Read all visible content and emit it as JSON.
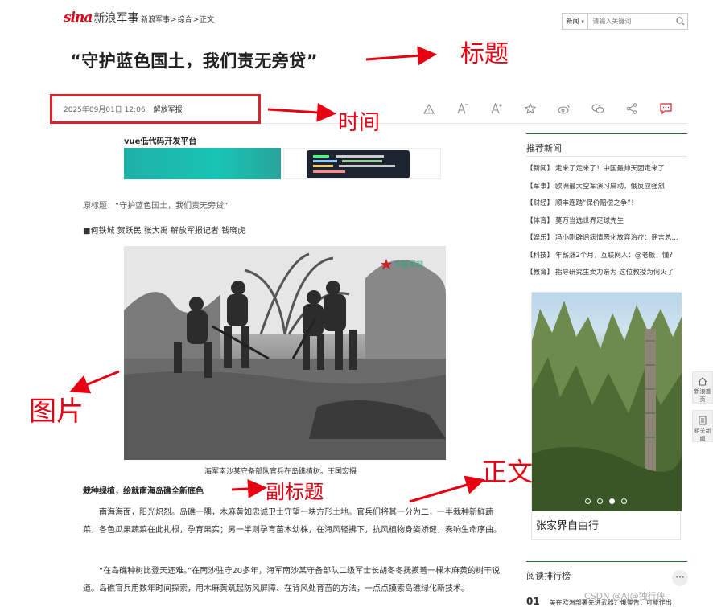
{
  "header": {
    "logo_brand": "sina",
    "logo_channel": "新浪军事",
    "breadcrumb": [
      "新浪军事",
      ">",
      "综合",
      ">",
      "正文"
    ],
    "search": {
      "scope": "新闻",
      "placeholder": "请输入关键词"
    }
  },
  "article": {
    "title": "“守护蓝色国土，我们责无旁贷”",
    "date": "2025年09月01日 12:06",
    "source": "解放军报",
    "toolbar": [
      "report-icon",
      "font-decrease-icon",
      "font-increase-icon",
      "favorite-icon",
      "weibo-icon",
      "wechat-icon",
      "share-icon",
      "comment-icon"
    ],
    "ad_title": "vue低代码开发平台",
    "original_title": "原标题：“守护蓝色国土，我们责无旁贷”",
    "authors": "■何铁城 贺跃民 张大禹 解放军报记者 钱晓虎",
    "photo_watermark": "中国军网",
    "photo_caption": "海军南沙某守备部队官兵在岛礁植树。王国宏摄",
    "subhead": "栽种绿植，绘就南海岛礁全新底色",
    "paragraphs": [
      "南海海面，阳光炽烈。岛礁一隅，木麻黄如忠诚卫士守望一块方形土地。官兵们将其一分为二，一半栽种新鲜蔬菜，各色瓜果蔬菜在此扎根，孕育果实；另一半则孕育苗木幼株，在海风轻拂下，抗风植物身姿娇健，奏响生命序曲。",
      "“在岛礁种树比登天还难。”在南沙驻守20多年，海军南沙某守备部队二级军士长胡冬冬抚摸着一棵木麻黄的树干说道。岛礁官兵用数年时间探索，用木麻黄筑起防风屏障、在背风处育苗的方法，一点点摸索岛礁绿化新技术。"
    ]
  },
  "annotations": {
    "title": "标题",
    "time": "时间",
    "image": "图片",
    "subtitle": "副标题",
    "body": "正文",
    "color": "#e60012"
  },
  "sidebar": {
    "recommend_title": "推荐新闻",
    "news": [
      {
        "tag": "【新闻】",
        "text": "走来了走来了！中国最帅天团走来了"
      },
      {
        "tag": "【军事】",
        "text": "欧洲最大空军演习启动，俄反应强烈"
      },
      {
        "tag": "【财经】",
        "text": "顺丰连踏“保价赔偿之争”！"
      },
      {
        "tag": "【体育】",
        "text": "莫万当选世界足球先生"
      },
      {
        "tag": "【娱乐】",
        "text": "冯小刚辟谣病情恶化放弃治疗：谣言总..."
      },
      {
        "tag": "【科技】",
        "text": "年薪涨2个月，互联网人：@老板，懂？"
      },
      {
        "tag": "【教育】",
        "text": "指导研究生卖力亲为 这位教授为何火了"
      }
    ],
    "card_caption": "张家界自由行",
    "carousel": {
      "count": 4,
      "active": 3
    },
    "ranking_title": "阅读排行榜",
    "ranking_first": {
      "num": "01",
      "text": "美在欧洲部署先进武器？俄警告：可能作出"
    },
    "more_label": "···"
  },
  "float_tools": [
    {
      "label": "新浪首页"
    },
    {
      "label": "相关新闻"
    }
  ],
  "watermark": "CSDN @AI@独行侠"
}
